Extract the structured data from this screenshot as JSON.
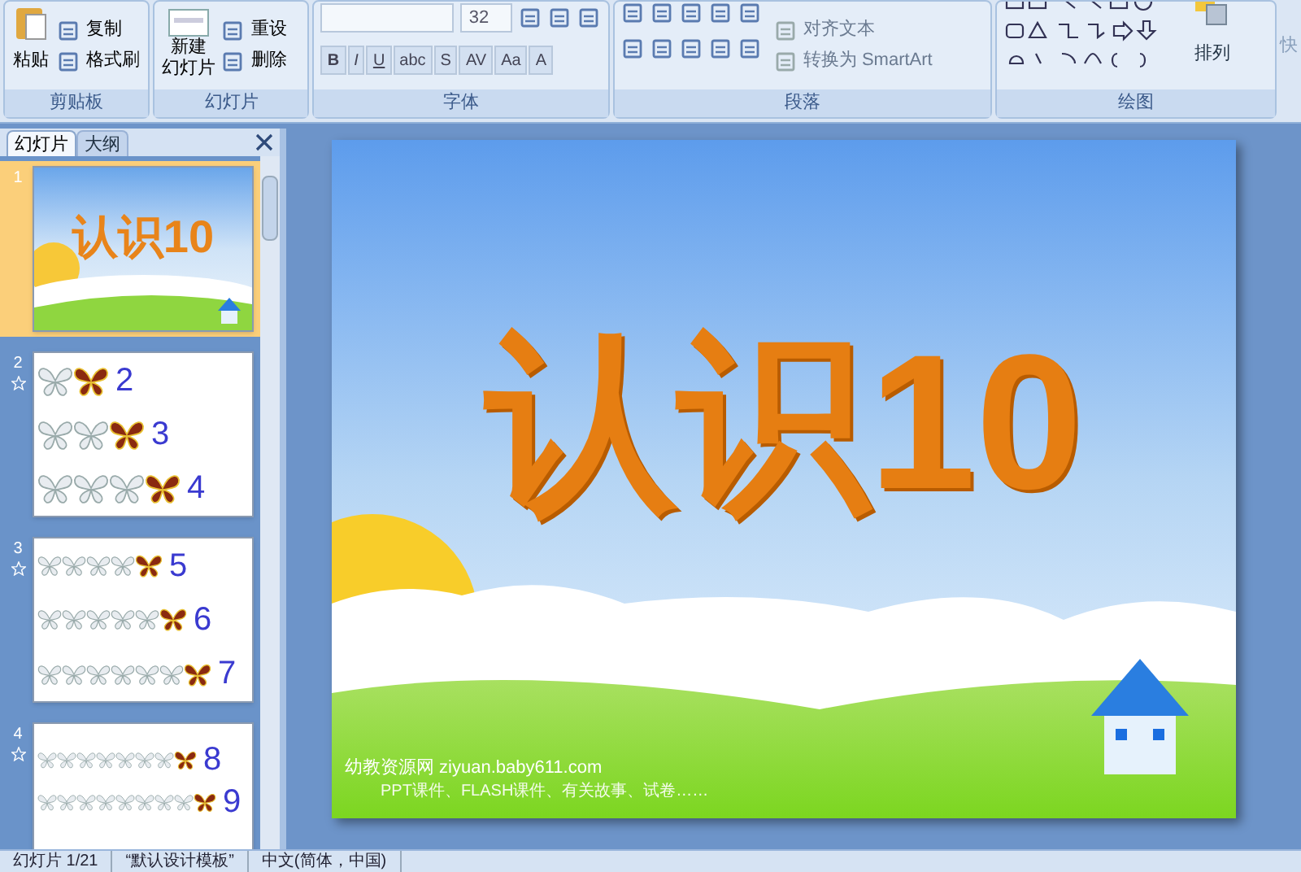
{
  "clipboard": {
    "label": "剪贴板",
    "paste": "粘贴",
    "items": [
      "复制",
      "格式刷"
    ]
  },
  "slides_group": {
    "label": "幻灯片",
    "new_slide": [
      "新建",
      "幻灯片"
    ],
    "items": [
      "重设",
      "删除"
    ]
  },
  "font": {
    "label": "字体",
    "size": "32",
    "format_buttons": [
      "B",
      "I",
      "U",
      "abc",
      "S",
      "AV",
      "Aa",
      "A"
    ]
  },
  "paragraph": {
    "label": "段落",
    "items": [
      "对齐文本",
      "转换为 SmartArt"
    ]
  },
  "drawing": {
    "label": "绘图",
    "arrange": "排列"
  },
  "quick": "快",
  "panel": {
    "tabs": [
      {
        "label": "幻灯片",
        "selected": true
      },
      {
        "label": "大纲",
        "selected": false
      }
    ]
  },
  "slides": [
    {
      "number": "1",
      "selected": true,
      "animated": false,
      "kind": "title",
      "title": "认识10"
    },
    {
      "number": "2",
      "selected": false,
      "animated": true,
      "kind": "butterflies",
      "rows": [
        {
          "butterflies": [
            {
              "kind": "white"
            },
            {
              "kind": "red"
            }
          ],
          "label": "2"
        },
        {
          "butterflies": [
            {
              "kind": "white"
            },
            {
              "kind": "white"
            },
            {
              "kind": "red"
            }
          ],
          "label": "3"
        },
        {
          "butterflies": [
            {
              "kind": "white"
            },
            {
              "kind": "white"
            },
            {
              "kind": "white"
            },
            {
              "kind": "red"
            }
          ],
          "label": "4"
        }
      ]
    },
    {
      "number": "3",
      "selected": false,
      "animated": true,
      "kind": "butterflies",
      "rows": [
        {
          "butterflies": [
            {
              "kind": "white"
            },
            {
              "kind": "white"
            },
            {
              "kind": "white"
            },
            {
              "kind": "white"
            },
            {
              "kind": "red"
            }
          ],
          "label": "5"
        },
        {
          "butterflies": [
            {
              "kind": "white"
            },
            {
              "kind": "white"
            },
            {
              "kind": "white"
            },
            {
              "kind": "white"
            },
            {
              "kind": "white"
            },
            {
              "kind": "red"
            }
          ],
          "label": "6"
        },
        {
          "butterflies": [
            {
              "kind": "white"
            },
            {
              "kind": "white"
            },
            {
              "kind": "white"
            },
            {
              "kind": "white"
            },
            {
              "kind": "white"
            },
            {
              "kind": "white"
            },
            {
              "kind": "red"
            }
          ],
          "label": "7"
        }
      ]
    },
    {
      "number": "4",
      "selected": false,
      "animated": true,
      "kind": "butterflies",
      "rows": [
        {
          "butterflies": [
            {
              "kind": "white"
            },
            {
              "kind": "white"
            },
            {
              "kind": "white"
            },
            {
              "kind": "white"
            },
            {
              "kind": "white"
            },
            {
              "kind": "white"
            },
            {
              "kind": "white"
            },
            {
              "kind": "red"
            }
          ],
          "label": "8"
        },
        {
          "butterflies": [
            {
              "kind": "white"
            },
            {
              "kind": "white"
            },
            {
              "kind": "white"
            },
            {
              "kind": "white"
            },
            {
              "kind": "white"
            },
            {
              "kind": "white"
            },
            {
              "kind": "white"
            },
            {
              "kind": "white"
            },
            {
              "kind": "red"
            }
          ],
          "label": "9"
        }
      ]
    }
  ],
  "main_slide": {
    "title": "认识10",
    "footer": "幼教资源网 ziyuan.baby611.com",
    "footer_note": "PPT课件、FLASH课件、有关故事、试卷……"
  },
  "status_bar": [
    "幻灯片 1/21",
    "“默认设计模板”",
    "中文(简体，中国)"
  ]
}
